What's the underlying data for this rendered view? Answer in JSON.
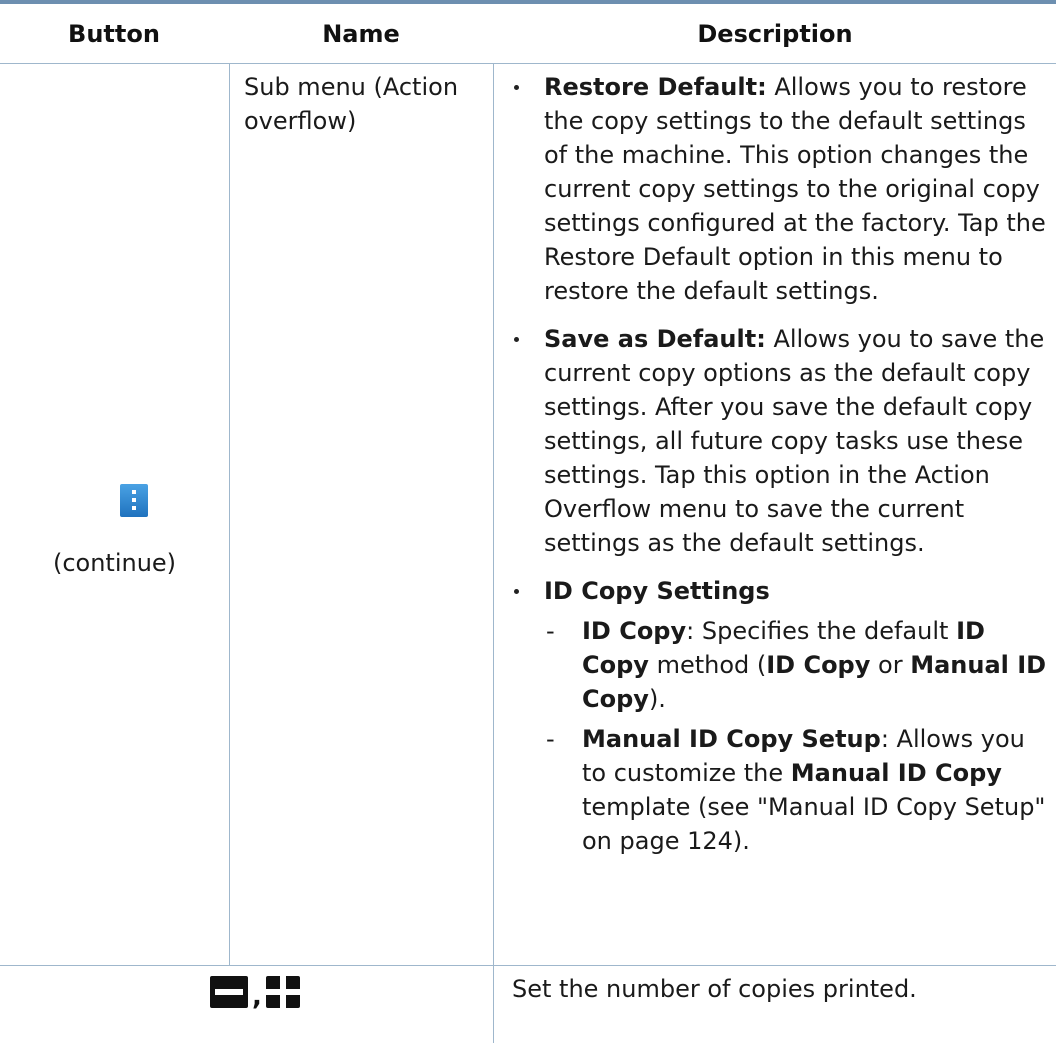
{
  "table": {
    "headers": {
      "button": "Button",
      "name": "Name",
      "description": "Description"
    },
    "rows": [
      {
        "button_icon": "action-overflow-icon",
        "button_caption": "(continue)",
        "name": "Sub menu (Action overflow)",
        "items": [
          {
            "term": "Restore Default:",
            "text": " Allows you to restore the copy settings to the default settings of the machine. This option changes the current copy settings to the original copy settings configured at the factory. Tap the Restore Default option in this menu to restore the default settings."
          },
          {
            "term": "Save as Default:",
            "text": " Allows you to save the current copy options as the default copy settings. After you save the default copy settings, all future copy tasks use these settings. Tap this option in the Action Overflow menu to save the current settings as the default settings."
          },
          {
            "term": "ID Copy Settings",
            "subitems": [
              {
                "dash": "-",
                "t1": "ID Copy",
                "t2": ": Specifies the default ",
                "t3": "ID Copy",
                "t4": " method (",
                "t5": "ID Copy",
                "t6": " or ",
                "t7": "Manual ID Copy",
                "t8": ")."
              },
              {
                "dash": "-",
                "t1": "Manual ID Copy Setup",
                "t2": ": Allows you to customize the ",
                "t3": "Manual ID Copy",
                "t4": " template (see \"Manual ID Copy Setup\" on page 124)."
              }
            ]
          }
        ]
      },
      {
        "button_icons": [
          "minus-icon",
          "plus-icon"
        ],
        "separator": ",",
        "description": "Set the number of copies printed."
      }
    ]
  },
  "colors": {
    "header_bar": "#6d8fb0",
    "grid": "#9fb7cc",
    "icon_blue": "#2a86d4",
    "icon_black": "#111111"
  }
}
